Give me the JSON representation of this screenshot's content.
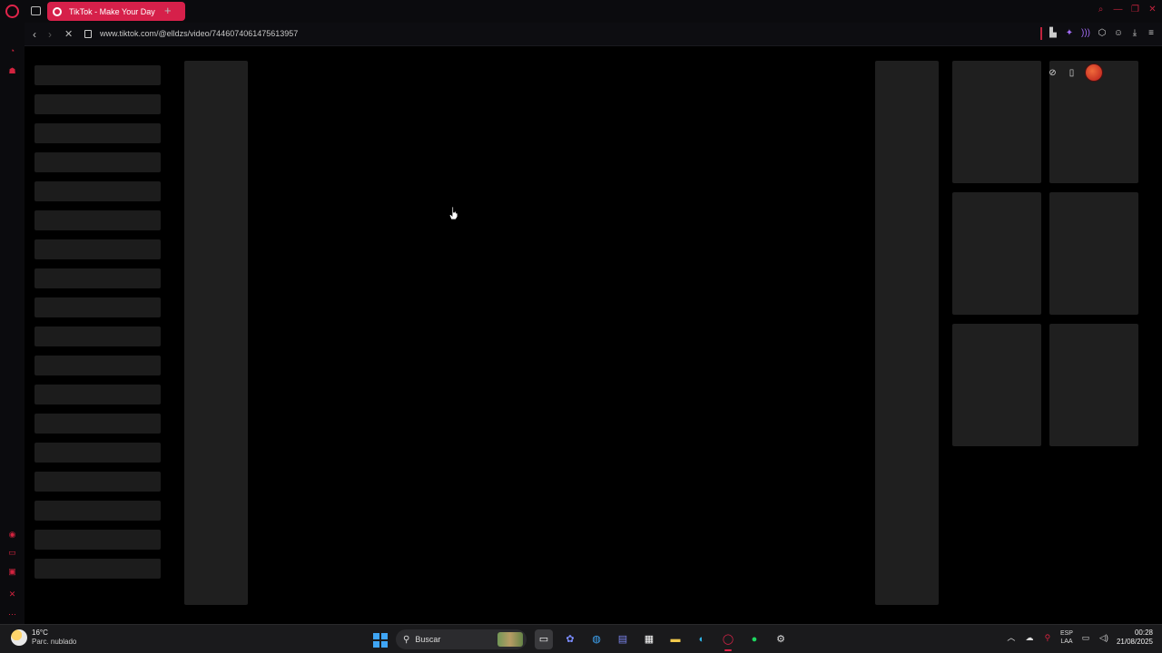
{
  "browser": {
    "tab": {
      "title": "TikTok - Make Your Day"
    },
    "address": {
      "url": "www.tiktok.com/@elldzs/video/7446074061475613957"
    }
  },
  "page": {
    "nav_skeleton_count": 18,
    "grid_skeleton_count": 6
  },
  "taskbar": {
    "weather": {
      "temp": "16°C",
      "desc": "Parc. nublado"
    },
    "search": {
      "placeholder": "Buscar"
    },
    "lang": {
      "line1": "ESP",
      "line2": "LAA"
    },
    "clock": {
      "time": "00:28",
      "date": "21/08/2025"
    }
  },
  "colors": {
    "accent": "#d6204a",
    "background": "#000000",
    "skeleton": "#1f1f1f"
  }
}
